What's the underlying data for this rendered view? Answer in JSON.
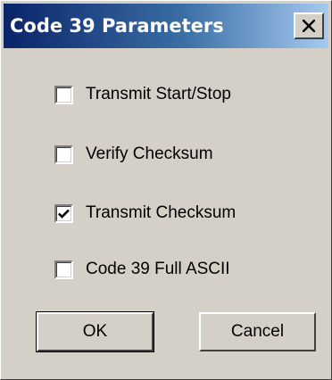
{
  "window": {
    "title": "Code 39 Parameters",
    "close_label": "close"
  },
  "options": [
    {
      "label": "Transmit Start/Stop",
      "checked": false
    },
    {
      "label": "Verify Checksum",
      "checked": false
    },
    {
      "label": "Transmit Checksum",
      "checked": true
    },
    {
      "label": "Code 39 Full ASCII",
      "checked": false
    }
  ],
  "buttons": {
    "ok_label": "OK",
    "cancel_label": "Cancel"
  },
  "colors": {
    "titlebar_start": "#0a246a",
    "titlebar_end": "#a6caf0",
    "face": "#d4d0c8"
  },
  "icons": {
    "close": "close-icon",
    "check": "checkmark-icon"
  }
}
